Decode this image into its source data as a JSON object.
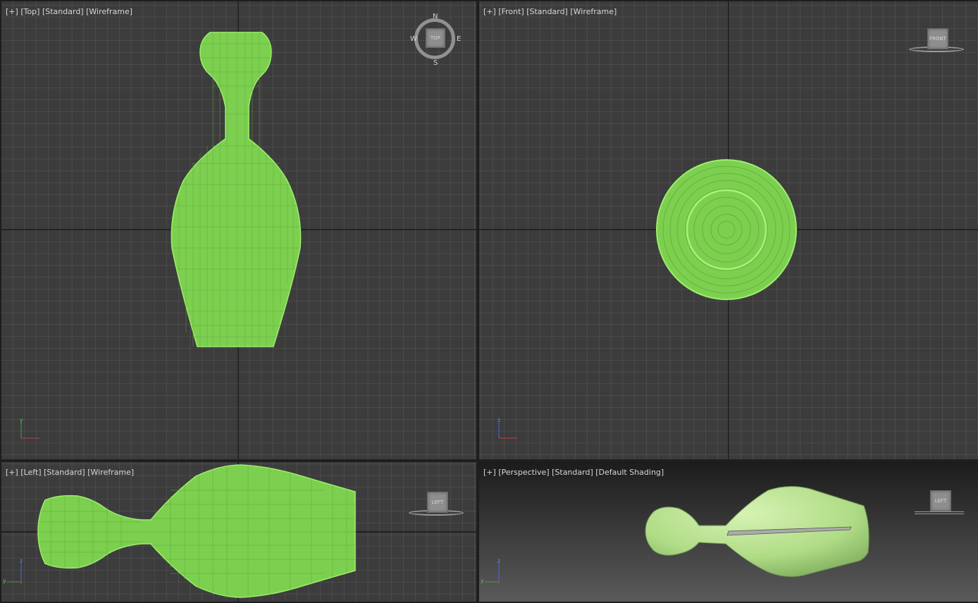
{
  "viewports": {
    "top": {
      "labels": {
        "plus": "[+]",
        "view": "[Top]",
        "style": "[Standard]",
        "shading": "[Wireframe]"
      },
      "navcube": {
        "face": "TOP",
        "n": "N",
        "s": "S",
        "e": "E",
        "w": "W"
      },
      "axes": {
        "v": "y",
        "h": "x"
      }
    },
    "front": {
      "labels": {
        "plus": "[+]",
        "view": "[Front]",
        "style": "[Standard]",
        "shading": "[Wireframe]"
      },
      "navcube": {
        "face": "FRONT"
      },
      "axes": {
        "v": "z",
        "h": "x"
      }
    },
    "left": {
      "labels": {
        "plus": "[+]",
        "view": "[Left]",
        "style": "[Standard]",
        "shading": "[Wireframe]"
      },
      "navcube": {
        "face": "LEFT"
      },
      "axes": {
        "v": "z",
        "h": "y"
      }
    },
    "perspective": {
      "labels": {
        "plus": "[+]",
        "view": "[Perspective]",
        "style": "[Standard]",
        "shading": "[Default Shading]"
      },
      "navcube": {
        "face": "LEFT"
      },
      "axes": {
        "v": "z",
        "h": "y"
      },
      "active": true
    }
  },
  "colors": {
    "grid_bg": "#3b3b3b",
    "grid_line": "#555555",
    "grid_main": "#111111",
    "wire": "#86e05a",
    "wire_fill": "#9be86e",
    "shaded": "#b8e292",
    "active_border": "#b9a66a"
  }
}
